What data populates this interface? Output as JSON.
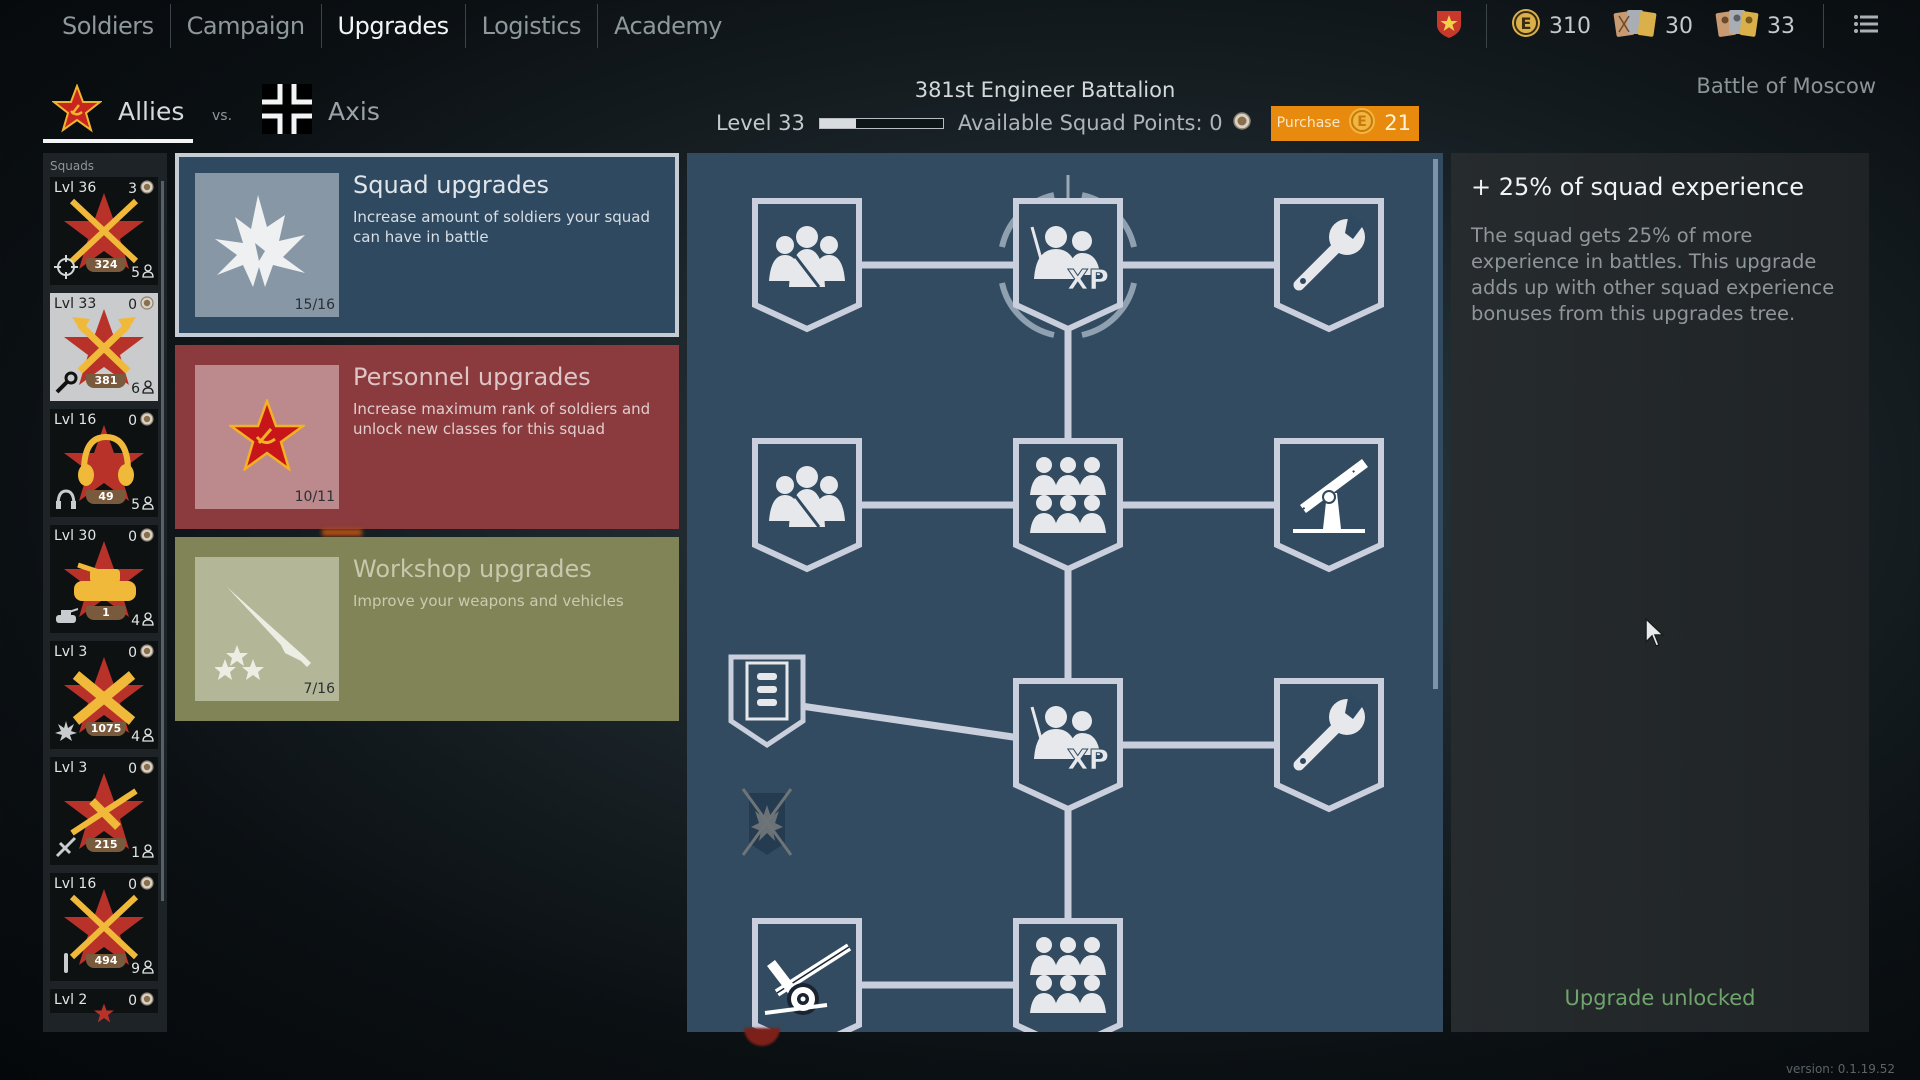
{
  "nav": {
    "tabs": [
      {
        "label": "Soldiers",
        "active": false
      },
      {
        "label": "Campaign",
        "active": false
      },
      {
        "label": "Upgrades",
        "active": true
      },
      {
        "label": "Logistics",
        "active": false
      },
      {
        "label": "Academy",
        "active": false
      }
    ]
  },
  "resources": {
    "rank_icon": "shield-star-icon",
    "gold": {
      "icon": "e-coin-icon",
      "value": "310"
    },
    "weapon_cards": {
      "icon": "weapon-cards-icon",
      "value": "30"
    },
    "soldier_cards": {
      "icon": "soldier-cards-icon",
      "value": "33"
    },
    "menu_icon": "list-menu-icon"
  },
  "factions": {
    "allies": {
      "label": "Allies",
      "icon": "soviet-star-icon",
      "selected": true
    },
    "vs": "vs.",
    "axis": {
      "label": "Axis",
      "icon": "balkenkreuz-icon",
      "selected": false
    }
  },
  "battalion": {
    "title": "381st Engineer Battalion",
    "level_label": "Level 33",
    "level_progress": 0.29,
    "squad_points_label": "Available Squad Points: 0",
    "purchase_label": "Purchase",
    "purchase_price": "21"
  },
  "battle_name": "Battle of Moscow",
  "sidebar": {
    "title": "Squads",
    "squads": [
      {
        "level": "Lvl 36",
        "points": "3",
        "emblem": "crossed-rifles",
        "class_icon": "crosshair-icon",
        "count": "324",
        "size": "5",
        "selected": false
      },
      {
        "level": "Lvl 33",
        "points": "0",
        "emblem": "crossed-axes",
        "class_icon": "wrench-icon",
        "count": "381",
        "size": "6",
        "selected": true
      },
      {
        "level": "Lvl 16",
        "points": "0",
        "emblem": "headphones",
        "class_icon": "headphones-icon",
        "count": "49",
        "size": "5",
        "selected": false
      },
      {
        "level": "Lvl 30",
        "points": "0",
        "emblem": "tank",
        "class_icon": "tank-icon",
        "count": "1",
        "size": "4",
        "selected": false
      },
      {
        "level": "Lvl 3",
        "points": "0",
        "emblem": "crossed-shells",
        "class_icon": "explosion-icon",
        "count": "1075",
        "size": "4",
        "selected": false
      },
      {
        "level": "Lvl 3",
        "points": "0",
        "emblem": "plane",
        "class_icon": "plane-icon",
        "count": "215",
        "size": "1",
        "selected": false
      },
      {
        "level": "Lvl 16",
        "points": "0",
        "emblem": "crossed-rifles",
        "class_icon": "bullet-icon",
        "count": "494",
        "size": "9",
        "selected": false
      },
      {
        "level": "Lvl 2",
        "points": "0",
        "emblem": "star",
        "class_icon": "",
        "count": "",
        "size": "",
        "selected": false
      }
    ]
  },
  "categories": [
    {
      "title": "Squad upgrades",
      "description": "Increase amount of soldiers your squad can have in battle",
      "progress": "15/16",
      "icon": "explosion-icon",
      "selected": true
    },
    {
      "title": "Personnel upgrades",
      "description": "Increase maximum rank of soldiers and unlock new classes for this squad",
      "progress": "10/11",
      "icon": "soviet-star-icon",
      "selected": false
    },
    {
      "title": "Workshop upgrades",
      "description": "Improve your weapons and vehicles",
      "progress": "7/16",
      "icon": "rifle-stars-icon",
      "selected": false
    }
  ],
  "tree": {
    "nodes": [
      {
        "id": "n1",
        "icon": "squad-group-icon",
        "label": "Squad size"
      },
      {
        "id": "n2",
        "icon": "squad-xp-icon",
        "label": "+25% squad experience",
        "selected": true
      },
      {
        "id": "n3",
        "icon": "wrench-icon",
        "label": "Engineer upgrade"
      },
      {
        "id": "n4",
        "icon": "squad-group-icon",
        "label": "Squad size"
      },
      {
        "id": "n5",
        "icon": "large-squad-icon",
        "label": "Large squad"
      },
      {
        "id": "n6",
        "icon": "aa-gun-icon",
        "label": "AA gun"
      },
      {
        "id": "n7",
        "icon": "ammo-list-icon",
        "label": "Ammo"
      },
      {
        "id": "n8",
        "icon": "explosion-locked-icon",
        "label": "Locked"
      },
      {
        "id": "n9",
        "icon": "squad-xp-icon",
        "label": "Squad experience"
      },
      {
        "id": "n10",
        "icon": "wrench-icon",
        "label": "Engineer upgrade"
      },
      {
        "id": "n11",
        "icon": "field-gun-icon",
        "label": "Field gun"
      },
      {
        "id": "n12",
        "icon": "large-squad-icon",
        "label": "Large squad"
      }
    ]
  },
  "detail": {
    "title": "+ 25% of squad experience",
    "description": "The squad gets 25% of more experience in battles. This upgrade adds up with other squad experience bonuses from this upgrades tree.",
    "status": "Upgrade unlocked"
  },
  "version": "version: 0.1.19.52",
  "colors": {
    "accent_purchase": "#e88a0d",
    "squad_card": "#2f4a60",
    "personnel_card": "#8b3b3d",
    "workshop_card": "#818456",
    "tree_bg": "#324b60",
    "status_green": "#6fa46d"
  }
}
